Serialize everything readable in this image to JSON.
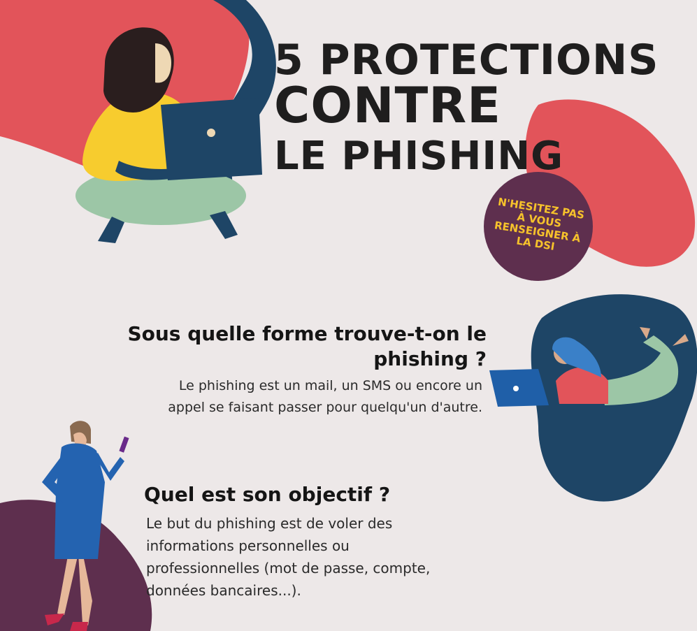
{
  "title": {
    "line1": "5 PROTECTIONS",
    "line2": "CONTRE",
    "line3": "LE PHISHING"
  },
  "badge": {
    "text": "N'HESITEZ PAS À VOUS RENSEIGNER À LA DSI"
  },
  "section1": {
    "question": "Sous quelle forme trouve-t-on le phishing ?",
    "answer": "Le phishing est un mail, un SMS ou encore un appel se faisant passer pour quelqu'un d'autre."
  },
  "section2": {
    "question": "Quel est son objectif ?",
    "answer": "Le but du phishing est de voler des informations personnelles ou professionnelles (mot de passe, compte, données bancaires...)."
  },
  "colors": {
    "background": "#EDE8E8",
    "coral": "#E2545A",
    "navy": "#1E4566",
    "plum": "#5E2F4E",
    "yellow": "#F6C22B",
    "mint": "#9CC6A6"
  }
}
